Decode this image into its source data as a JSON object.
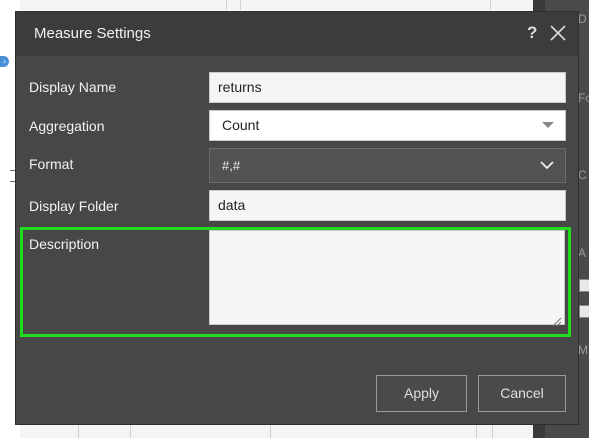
{
  "dialog": {
    "title": "Measure Settings",
    "help_label": "?",
    "close_icon": "close-icon",
    "fields": {
      "display_name": {
        "label": "Display Name",
        "value": "returns"
      },
      "aggregation": {
        "label": "Aggregation",
        "value": "Count"
      },
      "format": {
        "label": "Format",
        "value": "#,#"
      },
      "display_folder": {
        "label": "Display Folder",
        "value": "data"
      },
      "description": {
        "label": "Description",
        "value": ""
      }
    },
    "buttons": {
      "apply": "Apply",
      "cancel": "Cancel"
    },
    "highlight_color": "#1fdc1f"
  },
  "background": {
    "right_panel_letters": [
      "D",
      "Fo",
      "C",
      "A",
      "M"
    ]
  },
  "colors": {
    "dialog_bg": "#474747",
    "header_bg": "#3c3c3c",
    "input_bg": "#f5f5f5"
  }
}
